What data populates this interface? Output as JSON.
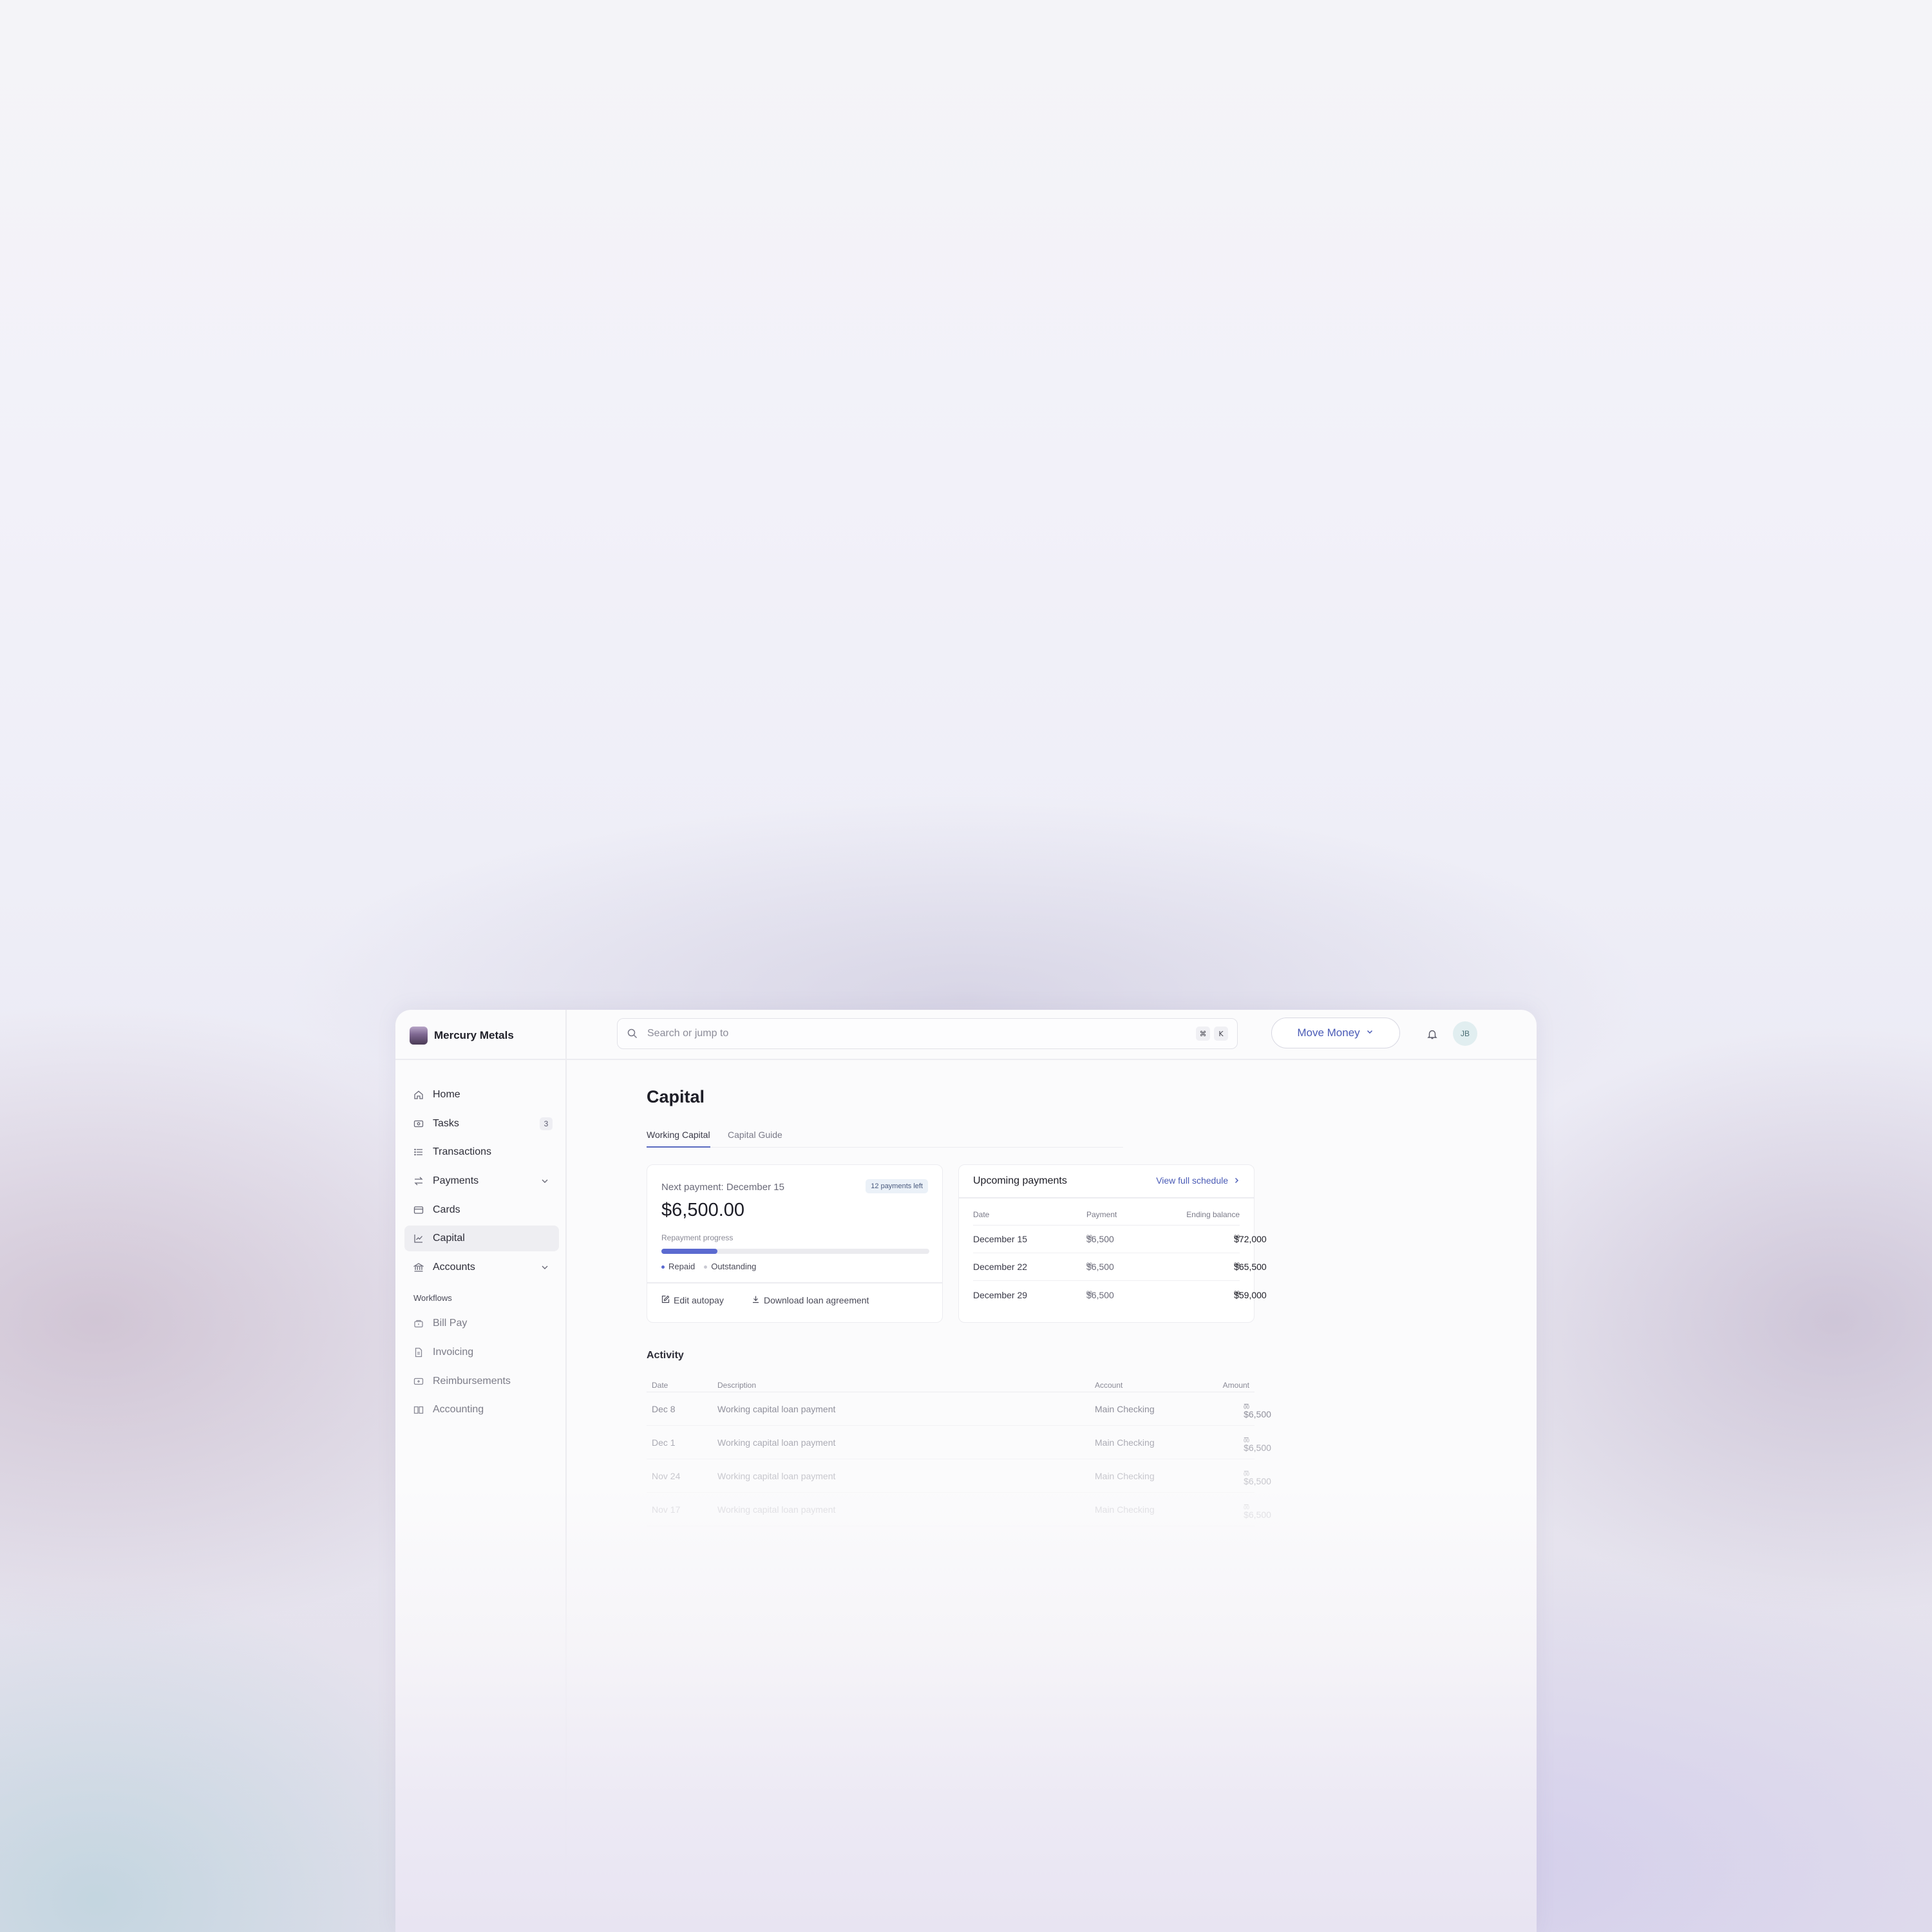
{
  "app": {
    "org_name": "Mercury Metals"
  },
  "sidebar": {
    "items": [
      {
        "label": "Home",
        "icon": "home-icon"
      },
      {
        "label": "Tasks",
        "icon": "tasks-icon",
        "badge": "3"
      },
      {
        "label": "Transactions",
        "icon": "list-icon"
      },
      {
        "label": "Payments",
        "icon": "transfer-icon"
      },
      {
        "label": "Cards",
        "icon": "card-icon"
      },
      {
        "label": "Capital",
        "icon": "chart-icon",
        "active": true
      },
      {
        "label": "Accounts",
        "icon": "bank-icon"
      }
    ],
    "workflows_label": "Workflows",
    "workflows": [
      {
        "label": "Bill Pay",
        "icon": "bill-icon"
      },
      {
        "label": "Invoicing",
        "icon": "invoice-icon"
      },
      {
        "label": "Reimbursements",
        "icon": "reimbursement-icon"
      },
      {
        "label": "Accounting",
        "icon": "accounting-icon"
      }
    ]
  },
  "topbar": {
    "search_placeholder": "Search or jump to",
    "shortcut_keys": [
      "⌘",
      "K"
    ],
    "move_money_label": "Move Money",
    "avatar_initials": "JB"
  },
  "page": {
    "title": "Capital",
    "tabs": [
      "Working Capital",
      "Capital Guide"
    ],
    "active_tab": "Working Capital"
  },
  "next_payment": {
    "label": "Next payment: December 15",
    "payments_left": "12 payments left",
    "amount": "$6,500.00",
    "progress_label": "Repayment progress",
    "progress_fraction": 0.21,
    "legend_repaid": "Repaid",
    "legend_outstanding": "Outstanding",
    "edit_autopay": "Edit autopay",
    "download_agreement": "Download loan agreement"
  },
  "upcoming": {
    "title": "Upcoming payments",
    "view_link": "View full schedule",
    "headers": [
      "Date",
      "Payment",
      "Ending balance"
    ],
    "rows": [
      {
        "date": "December 15",
        "payment": "$6,500",
        "payment_cents": "00",
        "balance": "$72,000",
        "balance_cents": "00"
      },
      {
        "date": "December 22",
        "payment": "$6,500",
        "payment_cents": "00",
        "balance": "$65,500",
        "balance_cents": "00"
      },
      {
        "date": "December 29",
        "payment": "$6,500",
        "payment_cents": "00",
        "balance": "$59,000",
        "balance_cents": "00"
      }
    ]
  },
  "activity": {
    "title": "Activity",
    "headers": [
      "Date",
      "Description",
      "Account",
      "Amount"
    ],
    "rows": [
      {
        "date": "Dec 8",
        "description": "Working capital loan payment",
        "account": "Main Checking",
        "amount": "−$6,500",
        "cents": "00"
      },
      {
        "date": "Dec 1",
        "description": "Working capital loan payment",
        "account": "Main Checking",
        "amount": "−$6,500",
        "cents": "00"
      },
      {
        "date": "Nov 24",
        "description": "Working capital loan payment",
        "account": "Main Checking",
        "amount": "−$6,500",
        "cents": "00"
      },
      {
        "date": "Nov 17",
        "description": "Working capital loan payment",
        "account": "Main Checking",
        "amount": "−$6,500",
        "cents": "00"
      }
    ]
  },
  "colors": {
    "accent": "#5b6ad0",
    "link": "#4a5bb6",
    "outstanding_dot": "#c9c9d2"
  }
}
